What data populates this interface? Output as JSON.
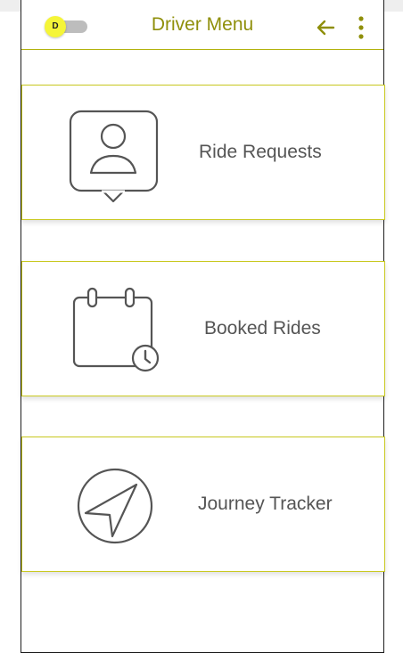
{
  "header": {
    "title": "Driver Menu",
    "toggle_letter": "D",
    "toggle_on": false,
    "back_icon": "arrow-left-icon",
    "menu_icon": "more-vertical-icon"
  },
  "colors": {
    "accent": "#8f8f0a",
    "card_border": "#c9c920",
    "icon_stroke": "#555555",
    "toggle_knob": "#f5f538"
  },
  "menu": {
    "items": [
      {
        "label": "Ride Requests",
        "icon": "user-chat-icon"
      },
      {
        "label": "Booked Rides",
        "icon": "calendar-clock-icon"
      },
      {
        "label": "Journey Tracker",
        "icon": "navigation-icon"
      }
    ]
  }
}
